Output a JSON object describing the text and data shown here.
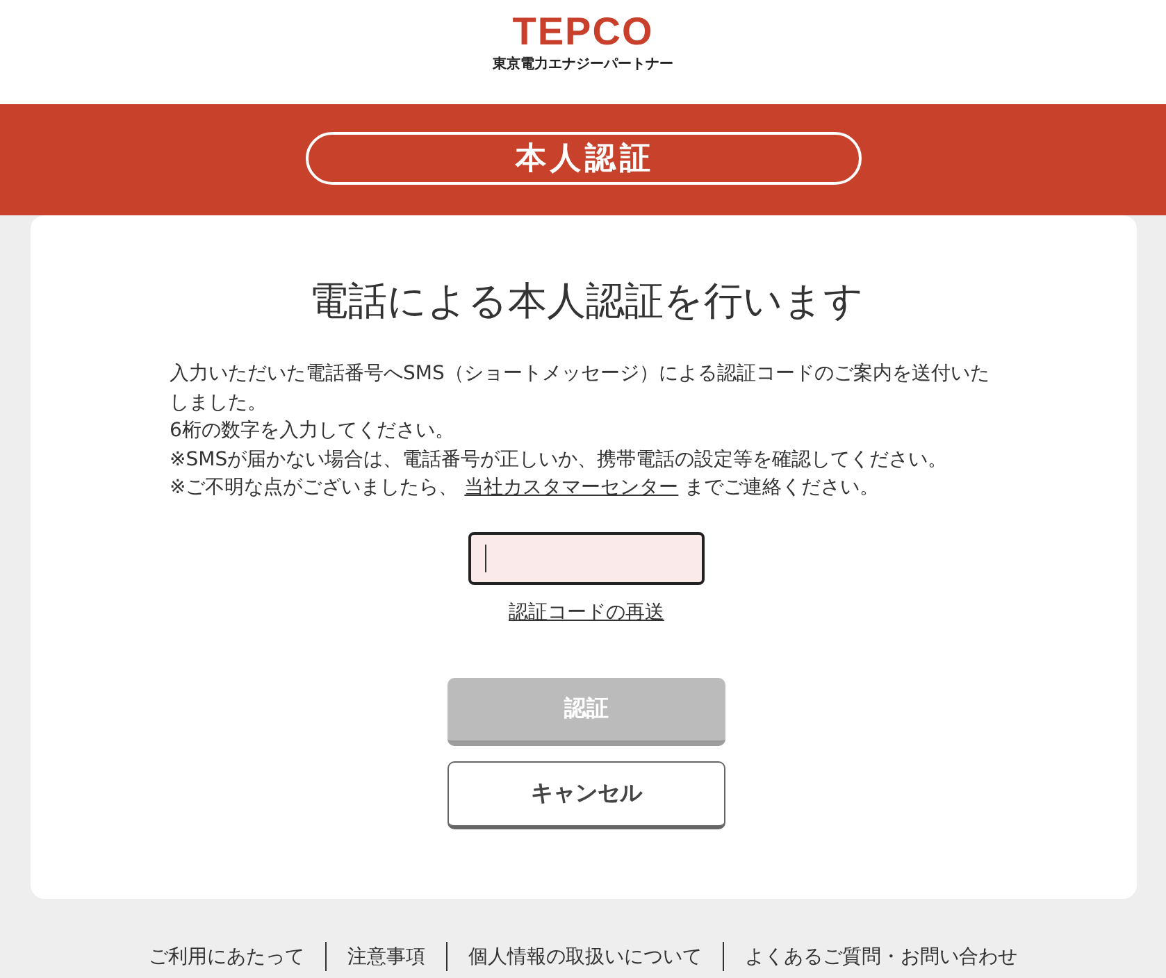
{
  "header": {
    "logo": "TEPCO",
    "company": "東京電力エナジーパートナー"
  },
  "page_title": "本人認証",
  "card": {
    "heading": "電話による本人認証を行います",
    "paragraphs": [
      "入力いただいた電話番号へSMS（ショートメッセージ）による認証コードのご案内を送付いたしました。",
      "6桁の数字を入力してください。",
      "※SMSが届かない場合は、電話番号が正しいか、携帯電話の設定等を確認してください。"
    ],
    "contact_note": {
      "before": "※ご不明な点がございましたら、 ",
      "link": "当社カスタマーセンター",
      "after": " までご連絡ください。"
    },
    "code_field": {
      "focused": true
    },
    "resend_link": "認証コードの再送",
    "buttons": [
      {
        "label": "認証",
        "kind": "primary",
        "disabled": true
      },
      {
        "label": "キャンセル",
        "kind": "secondary",
        "disabled": false
      }
    ]
  },
  "footer_links": [
    "ご利用にあたって",
    "注意事項",
    "個人情報の取扱いについて",
    "よくあるご質問・お問い合わせ"
  ]
}
